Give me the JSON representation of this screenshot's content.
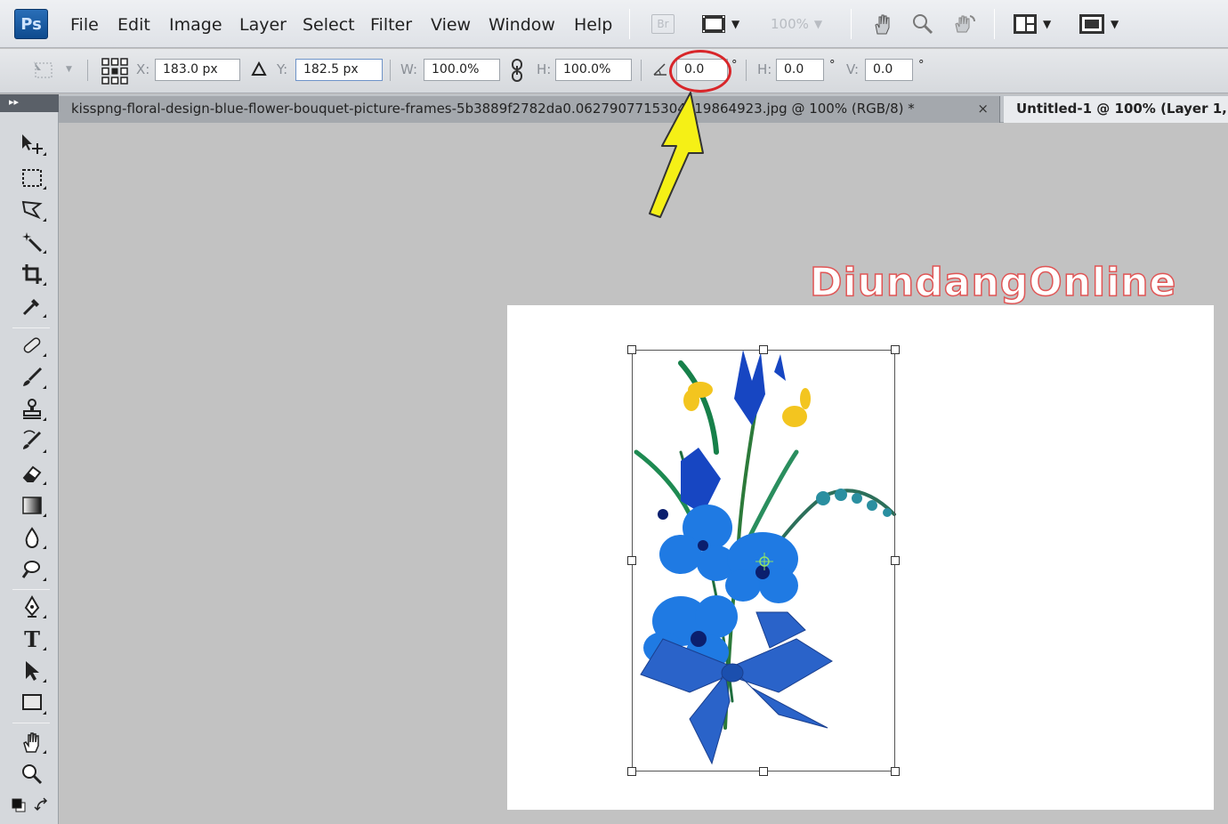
{
  "menubar": {
    "logo": "Ps",
    "items": [
      "File",
      "Edit",
      "Image",
      "Layer",
      "Select",
      "Filter",
      "View",
      "Window",
      "Help"
    ],
    "bridge_label": "Br",
    "zoom": "100%",
    "icons": [
      "film-strip-icon",
      "hand-icon",
      "zoom-icon",
      "rotate-view-icon",
      "arrange-documents-icon",
      "screen-mode-icon"
    ]
  },
  "options": {
    "x_label": "X:",
    "x_value": "183.0 px",
    "y_label": "Y:",
    "y_value": "182.5 px",
    "w_label": "W:",
    "w_value": "100.0%",
    "h_label": "H:",
    "h_value": "100.0%",
    "angle_value": "0.0",
    "degree_symbol": "°",
    "skew_h_label": "H:",
    "skew_h_value": "0.0",
    "skew_v_label": "V:",
    "skew_v_value": "0.0"
  },
  "tabs": [
    {
      "label": "kisspng-floral-design-blue-flower-bouquet-picture-frames-5b3889f2782da0.0627907715304319864923.jpg @ 100% (RGB/8) *",
      "active": true
    },
    {
      "label": "Untitled-1 @ 100% (Layer 1, R",
      "active": false
    }
  ],
  "tab_close": "×",
  "toolbox_collapse": "▸▸",
  "tools": [
    "move-tool",
    "marquee-tool",
    "lasso-tool",
    "magic-wand-tool",
    "crop-tool",
    "eyedropper-tool",
    "healing-brush-tool",
    "brush-tool",
    "clone-stamp-tool",
    "history-brush-tool",
    "eraser-tool",
    "gradient-tool",
    "blur-tool",
    "dodge-tool",
    "pen-tool",
    "type-tool",
    "path-selection-tool",
    "shape-tool",
    "hand-tool",
    "zoom-tool"
  ],
  "type_tool_glyph": "T",
  "watermark": "DiundangOnline",
  "annotation": {
    "circle_color": "#d8262a",
    "arrow_color": "#f5f016"
  }
}
